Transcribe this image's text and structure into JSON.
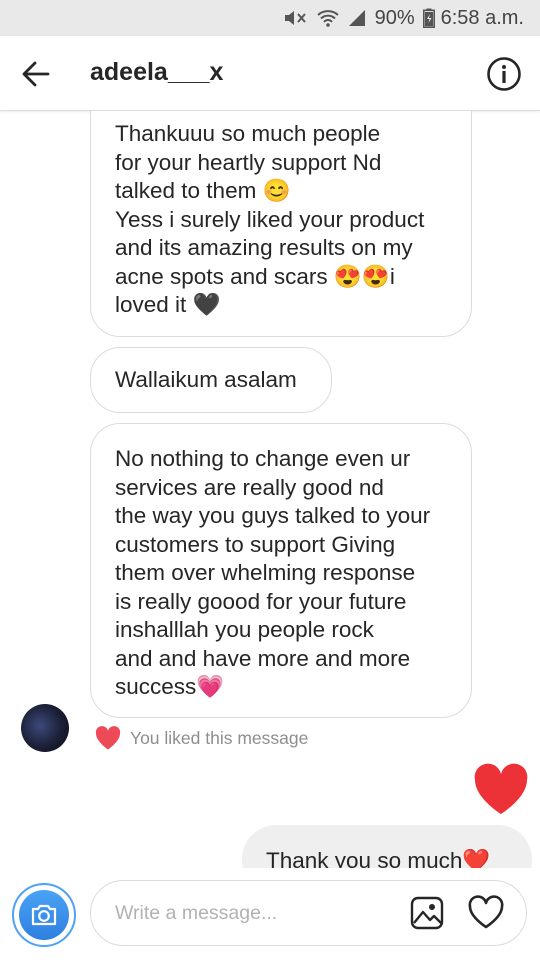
{
  "status_bar": {
    "battery": "90%",
    "time": "6:58 a.m.",
    "icons": [
      "mute-icon",
      "wifi-icon",
      "signal-icon",
      "battery-icon"
    ]
  },
  "header": {
    "username": "adeela___x",
    "back_icon": "arrow-left-icon",
    "info_icon": "info-icon"
  },
  "messages": [
    {
      "from": "other",
      "text": "Thankuuu so much people\nfor your heartly support   Nd\ntalked to them 😊\nYess i surely liked your product\nand its amazing results on my\nacne spots and scars 😍😍i\nloved it 🖤"
    },
    {
      "from": "other",
      "text": "Wallaikum asalam"
    },
    {
      "from": "other",
      "text": "No nothing to change even ur\nservices  are really good nd\nthe way you guys talked to your\ncustomers to support   Giving\nthem over whelming response\nis really goood for your future\ninshalllah you people rock\nand and have more and more\nsuccess💗"
    },
    {
      "from": "me",
      "type": "like",
      "text": "❤️"
    },
    {
      "from": "me",
      "text": "Thank you so much❤️"
    }
  ],
  "liked_note": "You liked this message",
  "composer": {
    "placeholder": "Write a message...",
    "camera_icon": "camera-icon",
    "gallery_icon": "gallery-icon",
    "heart_icon": "heart-outline-icon"
  },
  "colors": {
    "accent_blue": "#3897f0",
    "like_red": "#ed4956",
    "bubble_border": "#dbdbdb",
    "my_bubble_bg": "#efefef"
  }
}
